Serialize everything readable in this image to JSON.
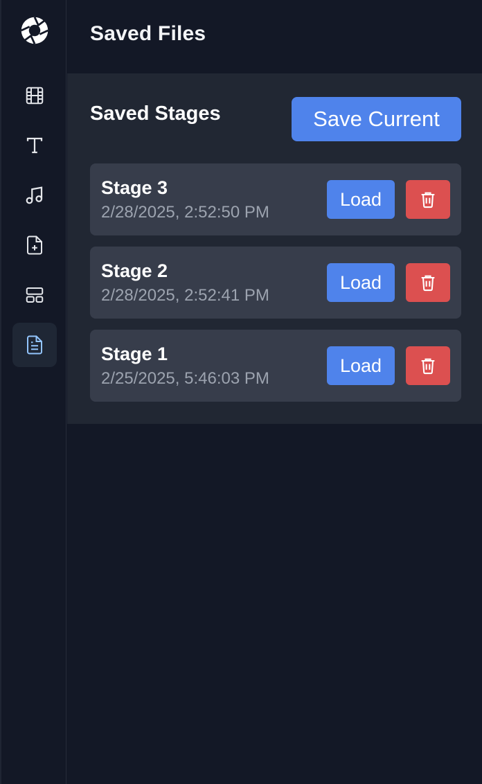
{
  "header": {
    "title": "Saved Files"
  },
  "sidebar": {
    "items": [
      {
        "icon": "film-icon"
      },
      {
        "icon": "text-icon"
      },
      {
        "icon": "music-note-icon"
      },
      {
        "icon": "file-plus-icon"
      },
      {
        "icon": "layout-icon"
      },
      {
        "icon": "document-icon",
        "active": true
      }
    ]
  },
  "panel": {
    "title": "Saved Stages",
    "save_label": "Save Current",
    "stages": [
      {
        "name": "Stage 3",
        "time": "2/28/2025, 2:52:50 PM",
        "load_label": "Load"
      },
      {
        "name": "Stage 2",
        "time": "2/28/2025, 2:52:41 PM",
        "load_label": "Load"
      },
      {
        "name": "Stage 1",
        "time": "2/25/2025, 5:46:03 PM",
        "load_label": "Load"
      }
    ]
  },
  "colors": {
    "background": "#131826",
    "panel": "#212733",
    "row": "#373d4b",
    "primary": "#4f83eb",
    "danger": "#dc5050",
    "muted_text": "#9ca3af",
    "active_icon": "#93c5fd"
  }
}
